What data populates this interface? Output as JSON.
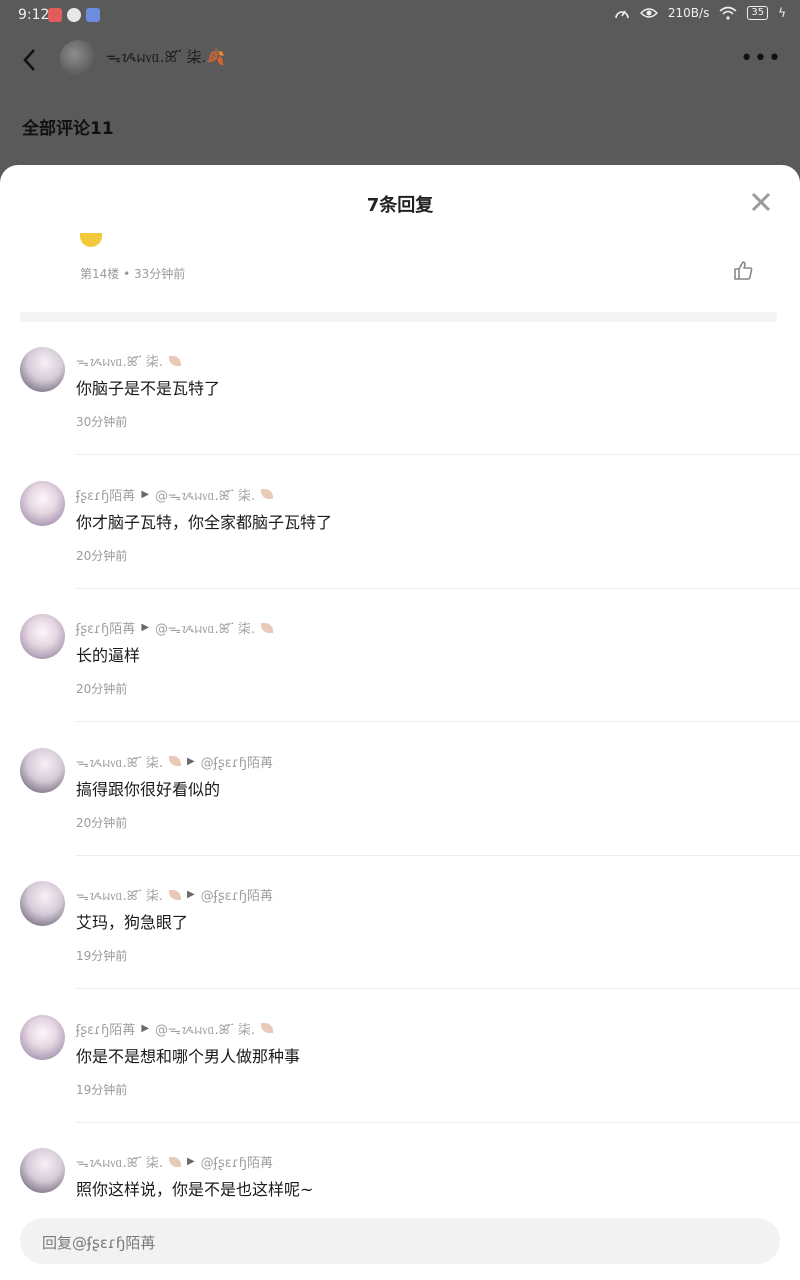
{
  "status": {
    "time": "9:12",
    "speed": "210B/s",
    "battery": "35"
  },
  "header": {
    "back_label": "<",
    "name": "ᯓᝰᥕ᥎ᥲ.ꕤ ፝ 柒.🍂",
    "more": "•••"
  },
  "background": {
    "title": "全部评论11"
  },
  "sheet": {
    "title": "7条回复",
    "root": {
      "meta": "第14楼 • 33分钟前"
    }
  },
  "replies": [
    {
      "author": "ᯓᝰᥕ᥎ᥲ.ꕤ ፝ 柒.",
      "target": "",
      "content": "你脑子是不是瓦特了",
      "time": "30分钟前",
      "avatar": "boy"
    },
    {
      "author": "ʄʂɛɾɧ陌苒",
      "target": "@ᯓᝰᥕ᥎ᥲ.ꕤ ፝ 柒.",
      "content": "你才脑子瓦特，你全家都脑子瓦特了",
      "time": "20分钟前",
      "avatar": "girl"
    },
    {
      "author": "ʄʂɛɾɧ陌苒",
      "target": "@ᯓᝰᥕ᥎ᥲ.ꕤ ፝ 柒.",
      "content": "长的逼样",
      "time": "20分钟前",
      "avatar": "girl"
    },
    {
      "author": "ᯓᝰᥕ᥎ᥲ.ꕤ ፝ 柒.",
      "target": "@ʄʂɛɾɧ陌苒",
      "content": "搞得跟你很好看似的",
      "time": "20分钟前",
      "avatar": "boy"
    },
    {
      "author": "ᯓᝰᥕ᥎ᥲ.ꕤ ፝ 柒.",
      "target": "@ʄʂɛɾɧ陌苒",
      "content": "艾玛，狗急眼了",
      "time": "19分钟前",
      "avatar": "boy"
    },
    {
      "author": "ʄʂɛɾɧ陌苒",
      "target": "@ᯓᝰᥕ᥎ᥲ.ꕤ ፝ 柒.",
      "content": "你是不是想和哪个男人做那种事",
      "time": "19分钟前",
      "avatar": "girl"
    },
    {
      "author": "ᯓᝰᥕ᥎ᥲ.ꕤ ፝ 柒.",
      "target": "@ʄʂɛɾɧ陌苒",
      "content": "照你这样说，你是不是也这样呢~",
      "time": "",
      "avatar": "boy"
    }
  ],
  "input": {
    "placeholder": "回复@ʄʂɛɾɧ陌苒"
  }
}
